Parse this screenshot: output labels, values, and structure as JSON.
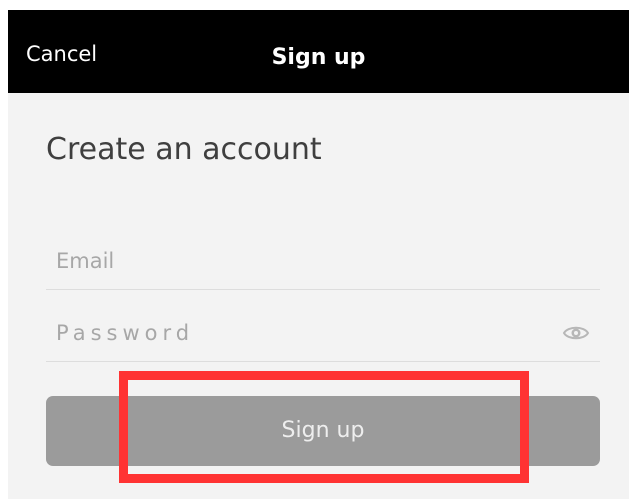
{
  "header": {
    "cancel_label": "Cancel",
    "title": "Sign up"
  },
  "form": {
    "heading": "Create an account",
    "email": {
      "placeholder": "Email",
      "value": ""
    },
    "password": {
      "placeholder": "Password",
      "value": ""
    },
    "submit_label": "Sign up"
  },
  "icons": {
    "password_visibility": "eye-icon"
  },
  "colors": {
    "header_background": "#000000",
    "page_background": "#f3f3f3",
    "button_background": "#9b9b9b",
    "highlight_border": "#ff3333"
  }
}
